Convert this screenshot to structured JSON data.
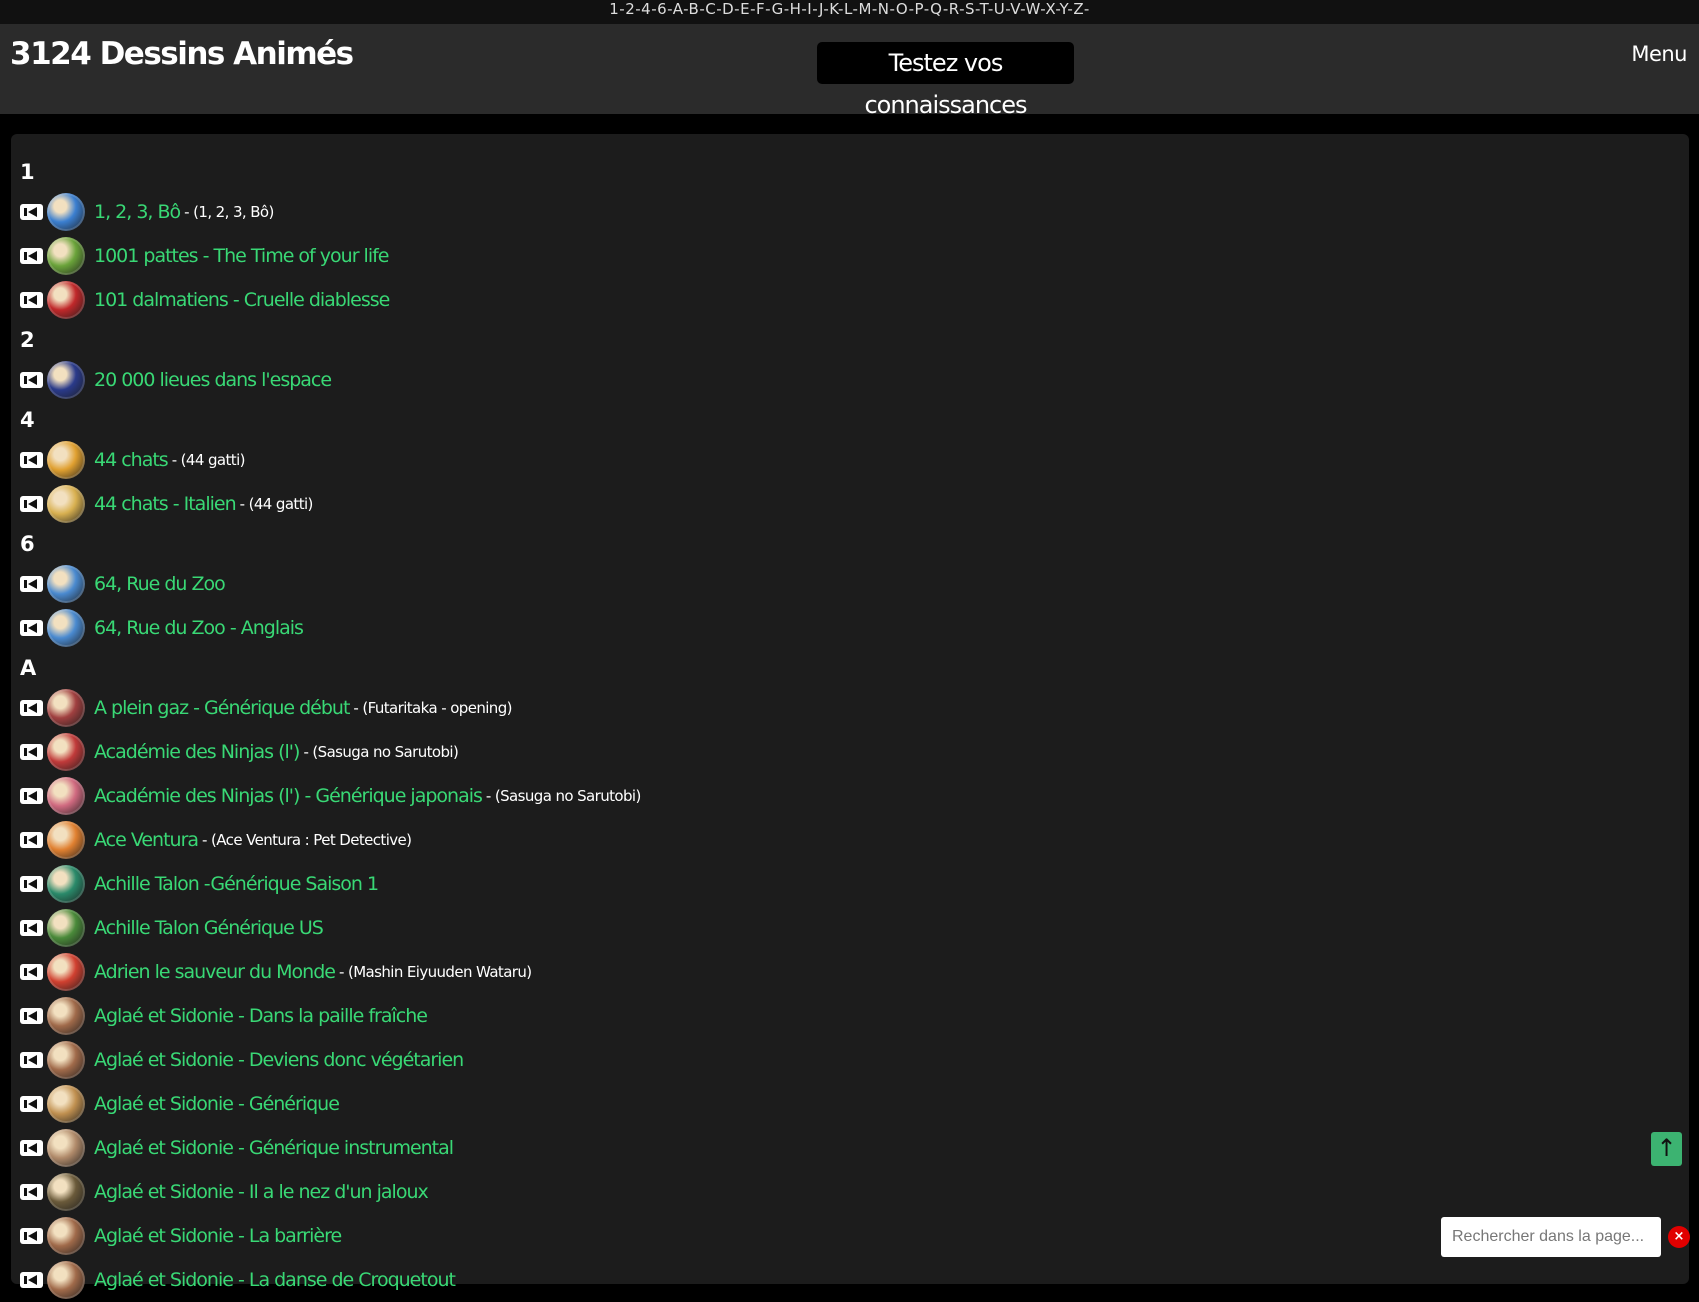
{
  "alphabet": "1-2-4-6-A-B-C-D-E-F-G-H-I-J-K-L-M-N-O-P-Q-R-S-T-U-V-W-X-Y-Z-",
  "header": {
    "site_title": "3124 Dessins Animés",
    "quiz_label": "Testez vos connaissances",
    "menu_label": "Menu"
  },
  "sections": [
    {
      "letter": "1",
      "items": [
        {
          "title": "1, 2, 3, Bô",
          "original": "- (1, 2, 3, Bô)",
          "thumb": "#3b7fd0"
        },
        {
          "title": "1001 pattes - The Time of your life",
          "original": "",
          "thumb": "#6aa33a"
        },
        {
          "title": "101 dalmatiens - Cruelle diablesse",
          "original": "",
          "thumb": "#c0282a"
        }
      ]
    },
    {
      "letter": "2",
      "items": [
        {
          "title": "20 000 lieues dans l'espace",
          "original": "",
          "thumb": "#2a3a8a"
        }
      ]
    },
    {
      "letter": "4",
      "items": [
        {
          "title": "44 chats",
          "original": "- (44 gatti)",
          "thumb": "#e0a030"
        },
        {
          "title": "44 chats - Italien",
          "original": "- (44 gatti)",
          "thumb": "#d8b050"
        }
      ]
    },
    {
      "letter": "6",
      "items": [
        {
          "title": "64, Rue du Zoo",
          "original": "",
          "thumb": "#4a8ad0"
        },
        {
          "title": "64, Rue du Zoo - Anglais",
          "original": "",
          "thumb": "#4a8ad0"
        }
      ]
    },
    {
      "letter": "A",
      "items": [
        {
          "title": "A plein gaz - Générique début",
          "original": "- (Futaritaka - opening)",
          "thumb": "#a04040"
        },
        {
          "title": "Académie des Ninjas (l')",
          "original": "- (Sasuga no Sarutobi)",
          "thumb": "#c03a3a"
        },
        {
          "title": "Académie des Ninjas (l') - Générique japonais",
          "original": "- (Sasuga no Sarutobi)",
          "thumb": "#d06a80"
        },
        {
          "title": "Ace Ventura",
          "original": "- (Ace Ventura : Pet Detective)",
          "thumb": "#e08030"
        },
        {
          "title": "Achille Talon -Générique Saison 1",
          "original": "",
          "thumb": "#2a8a6a"
        },
        {
          "title": "Achille Talon Générique US",
          "original": "",
          "thumb": "#4a8a3a"
        },
        {
          "title": "Adrien le sauveur du Monde",
          "original": "- (Mashin Eiyuuden Wataru)",
          "thumb": "#d04030"
        },
        {
          "title": "Aglaé et Sidonie - Dans la paille fraîche",
          "original": "",
          "thumb": "#a06a4a"
        },
        {
          "title": "Aglaé et Sidonie - Deviens donc végétarien",
          "original": "",
          "thumb": "#a06a4a"
        },
        {
          "title": "Aglaé et Sidonie - Générique",
          "original": "",
          "thumb": "#c09050"
        },
        {
          "title": "Aglaé et Sidonie - Générique instrumental",
          "original": "",
          "thumb": "#b08a6a"
        },
        {
          "title": "Aglaé et Sidonie - Il a le nez d'un jaloux",
          "original": "",
          "thumb": "#6a5a3a"
        },
        {
          "title": "Aglaé et Sidonie - La barrière",
          "original": "",
          "thumb": "#a06a4a"
        },
        {
          "title": "Aglaé et Sidonie - La danse de Croquetout",
          "original": "",
          "thumb": "#a06a4a"
        }
      ]
    }
  ],
  "scroll_top_icon": "arrow-up-icon",
  "search": {
    "placeholder": "Rechercher dans la page..."
  },
  "clear_label": "×"
}
